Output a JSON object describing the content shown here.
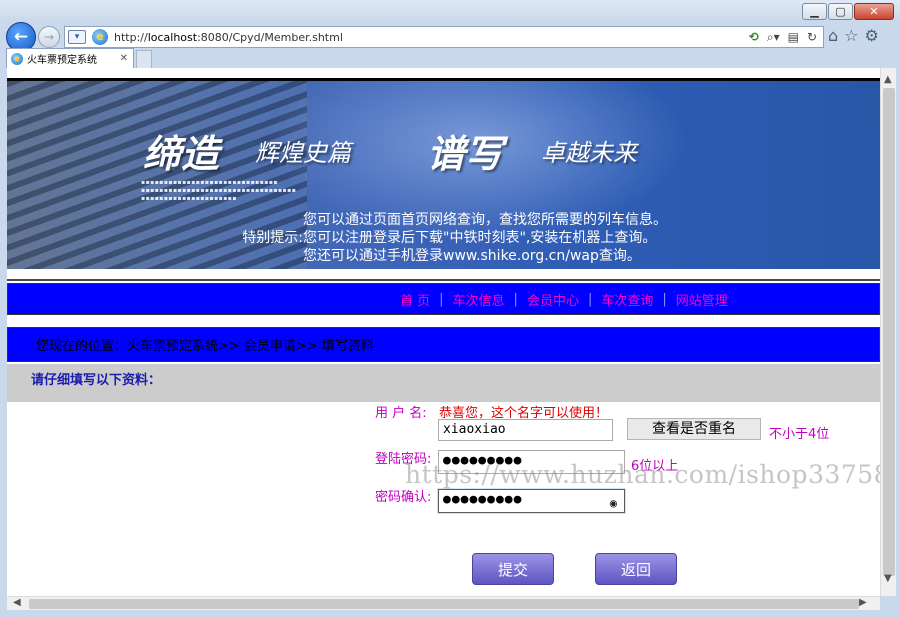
{
  "browser": {
    "window_controls": {
      "minimize": "▁",
      "maximize": "▢",
      "close": "✕"
    },
    "address_url_prefix": "http://",
    "address_url_host": "localhost",
    "address_url_rest": ":8080/Cpyd/Member.shtml",
    "tab_title": "火车票预定系统",
    "tab_close": "✕"
  },
  "banner": {
    "slogan_part1": "缔造",
    "slogan_part2": "辉煌史篇",
    "slogan_part3": "谱写",
    "slogan_part4": "卓越未来",
    "notice_label": "特别提示:",
    "notice_line1": "您可以通过页面首页网络查询，查找您所需要的列车信息。",
    "notice_line2": "您可以注册登录后下载\"中铁时刻表\",安装在机器上查询。",
    "notice_line3": "您还可以通过手机登录www.shike.org.cn/wap查询。"
  },
  "menu": {
    "items": [
      "首 页",
      "车次信息",
      "会员中心",
      "车次查询",
      "网站管理"
    ],
    "separator": "|"
  },
  "location": "您现在的位置：火车票预定系统>> 会员申请>> 填写资料",
  "form": {
    "heading": "请仔细填写以下资料：",
    "username_label": "用 户 名:",
    "username_message": "恭喜您，这个名字可以使用！",
    "username_value": "xiaoxiao",
    "check_button": "查看是否重名",
    "username_hint": "不小于4位",
    "password_label": "登陆密码:",
    "password_value": "●●●●●●●●●",
    "password_hint": "6位以上",
    "confirm_label": "密码确认:",
    "confirm_value": "●●●●●●●●●",
    "submit_button": "提交",
    "back_button": "返回"
  },
  "watermark": "https://www.huzhan.com/ishop33758",
  "colors": {
    "menu_bg": "#0000ff",
    "menu_text": "#ff00c8",
    "label_text": "#c000c0",
    "ok_message": "#e00000",
    "button_purple": "#6a5fd0"
  }
}
